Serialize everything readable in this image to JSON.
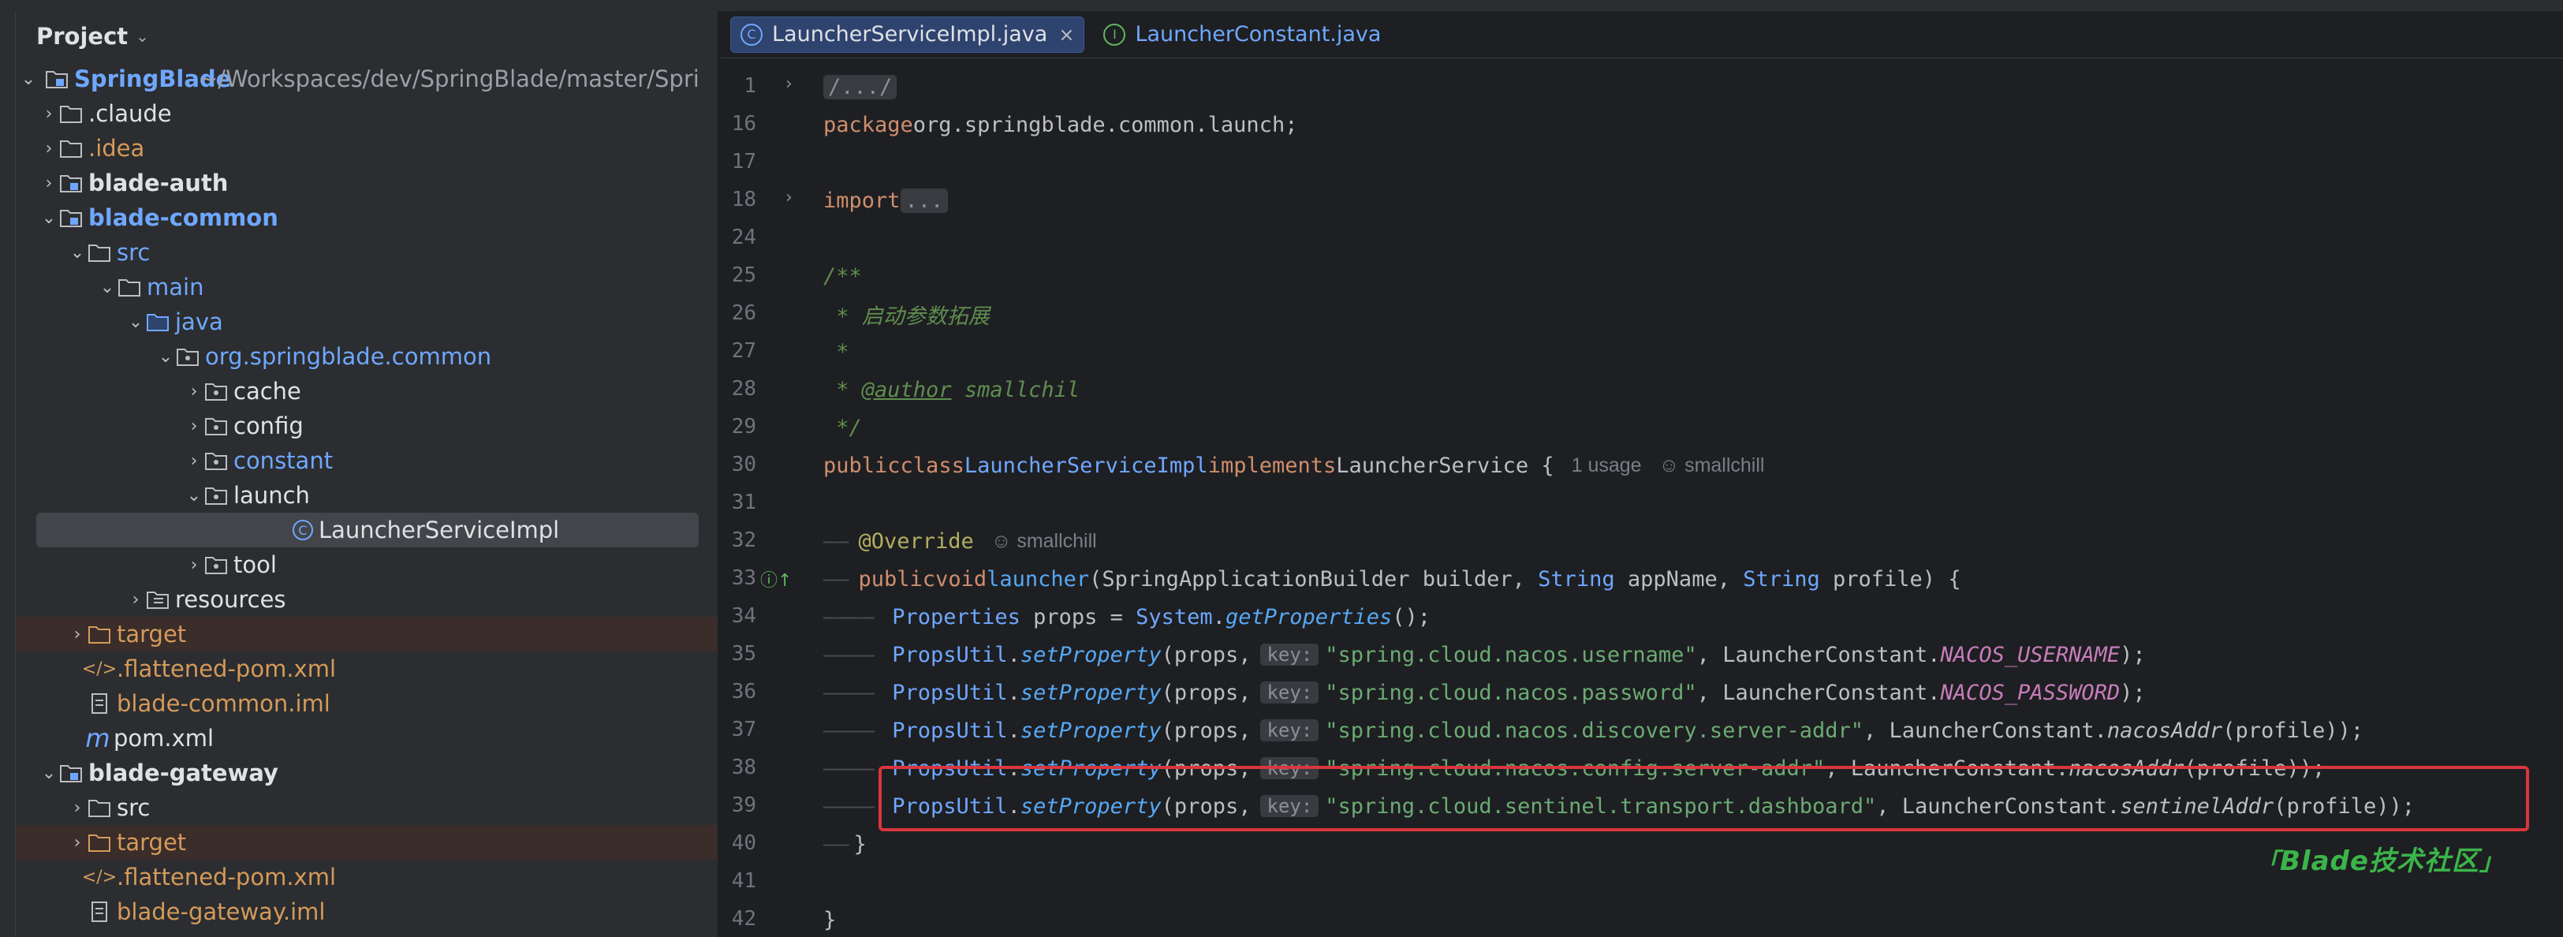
{
  "project_panel": {
    "title": "Project",
    "tree": [
      {
        "label": "SpringBlade",
        "path_suffix": " ~/Workspaces/dev/SpringBlade/master/Spri"
      },
      {
        "label": ".claude"
      },
      {
        "label": ".idea"
      },
      {
        "label": "blade-auth"
      },
      {
        "label": "blade-common"
      },
      {
        "label": "src"
      },
      {
        "label": "main"
      },
      {
        "label": "java"
      },
      {
        "label": "org.springblade.common"
      },
      {
        "label": "cache"
      },
      {
        "label": "config"
      },
      {
        "label": "constant"
      },
      {
        "label": "launch"
      },
      {
        "label": "LauncherServiceImpl"
      },
      {
        "label": "tool"
      },
      {
        "label": "resources"
      },
      {
        "label": "target"
      },
      {
        "label": ".flattened-pom.xml"
      },
      {
        "label": "blade-common.iml"
      },
      {
        "label": "pom.xml"
      },
      {
        "label": "blade-gateway"
      },
      {
        "label": "src"
      },
      {
        "label": "target"
      },
      {
        "label": ".flattened-pom.xml"
      },
      {
        "label": "blade-gateway.iml"
      }
    ]
  },
  "tabs": [
    {
      "label": "LauncherServiceImpl.java",
      "active": true
    },
    {
      "label": "LauncherConstant.java",
      "active": false
    }
  ],
  "line_numbers": [
    "1",
    "16",
    "17",
    "18",
    "24",
    "25",
    "26",
    "27",
    "28",
    "29",
    "30",
    "31",
    "32",
    "33",
    "34",
    "35",
    "36",
    "37",
    "38",
    "39",
    "40",
    "41",
    "42"
  ],
  "code": {
    "l1": "/.../",
    "l16_kw": "package",
    "l16_pkg": "org.springblade.common.launch",
    "l16_end": ";",
    "l18_kw": "import",
    "l18_dots": "...",
    "l25": "/**",
    "l26": " * 启动参数拓展",
    "l27": " *",
    "l28_star": " * ",
    "l28_tag": "@author",
    "l28_val": " smallchil",
    "l29": " */",
    "l30_kw1": "public",
    "l30_kw2": "class",
    "l30_cls": "LauncherServiceImpl",
    "l30_kw3": "implements",
    "l30_itf": "LauncherService",
    "l30_brace": " {",
    "l30_hint1": "1 usage",
    "l30_hint2": "smallchill",
    "l32_ann": "@Override",
    "l32_hint": "smallchill",
    "l33_kw1": "public",
    "l33_kw2": "void",
    "l33_fn": "launcher",
    "l33_p1": "(",
    "l33_t1": "SpringApplicationBuilder",
    "l33_a1": " builder, ",
    "l33_t2": "String",
    "l33_a2": " appName, ",
    "l33_t3": "String",
    "l33_a3": " profile) {",
    "l34_t": "Properties",
    "l34_a": " props = ",
    "l34_c": "System",
    "l34_d": ".",
    "l34_m": "getProperties",
    "l34_e": "();",
    "props_cls": "PropsUtil",
    "props_fn": "setProperty",
    "props_open": "(props,",
    "key_hint": "key:",
    "l35_str": "\"spring.cloud.nacos.username\"",
    "l35_cls": "LauncherConstant",
    "l35_cst": "NACOS_USERNAME",
    "l36_str": "\"spring.cloud.nacos.password\"",
    "l36_cst": "NACOS_PASSWORD",
    "l37_str": "\"spring.cloud.nacos.discovery.server-addr\"",
    "l37_fn": "nacosAddr",
    "l38_str": "\"spring.cloud.nacos.config.server-addr\"",
    "l38_fn": "nacosAddr",
    "l39_str": "\"spring.cloud.sentinel.transport.dashboard\"",
    "l39_fn": "sentinelAddr",
    "profile_close": "(profile));",
    "close_paren": ");",
    "l40": "}",
    "l42": "}"
  },
  "watermark": "Blade技术社区",
  "colors": {
    "highlight_border": "#d9363e",
    "watermark": "#3bb54a",
    "accent_blue": "#6fa7ff"
  }
}
